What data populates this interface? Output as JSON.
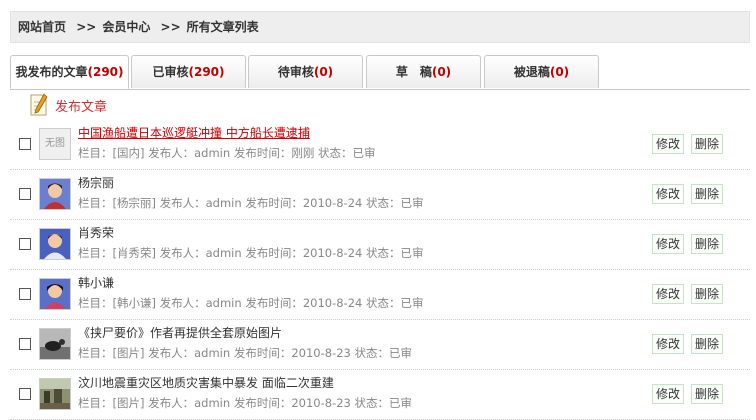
{
  "breadcrumb": {
    "home": "网站首页",
    "sep1": ">>",
    "member": "会员中心",
    "sep2": ">>",
    "current": "所有文章列表"
  },
  "tabs": [
    {
      "label": "我发布的文章",
      "count": "(290)"
    },
    {
      "label": "已审核",
      "count": "(290)"
    },
    {
      "label": "待审核",
      "count": "(0)"
    },
    {
      "label": "草　稿",
      "count": "(0)"
    },
    {
      "label": "被退稿",
      "count": "(0)"
    }
  ],
  "publish": {
    "label": "发布文章",
    "icon": "document-pencil-icon"
  },
  "actions": {
    "edit": "修改",
    "delete": "删除"
  },
  "thumbnail_placeholder": "无图",
  "articles": [
    {
      "title": "中国渔船遭日本巡逻艇冲撞 中方船长遭逮捕",
      "meta": "栏目：[国内] 发布人：admin 发布时间：刚刚 状态：已审",
      "thumb": "none"
    },
    {
      "title": "杨宗丽",
      "meta": "栏目：[杨宗丽] 发布人：admin 发布时间：2010-8-24 状态：已审",
      "thumb": "portrait"
    },
    {
      "title": "肖秀荣",
      "meta": "栏目：[肖秀荣] 发布人：admin 发布时间：2010-8-24 状态：已审",
      "thumb": "portrait"
    },
    {
      "title": "韩小谦",
      "meta": "栏目：[韩小谦] 发布人：admin 发布时间：2010-8-24 状态：已审",
      "thumb": "portrait"
    },
    {
      "title": "《挟尸要价》作者再提供全套原始图片",
      "meta": "栏目：[图片] 发布人：admin 发布时间：2010-8-23 状态：已审",
      "thumb": "photo-dark"
    },
    {
      "title": "汶川地震重灾区地质灾害集中暴发 面临二次重建",
      "meta": "栏目：[图片] 发布人：admin 发布时间：2010-8-23 状态：已审",
      "thumb": "photo-scene"
    }
  ]
}
